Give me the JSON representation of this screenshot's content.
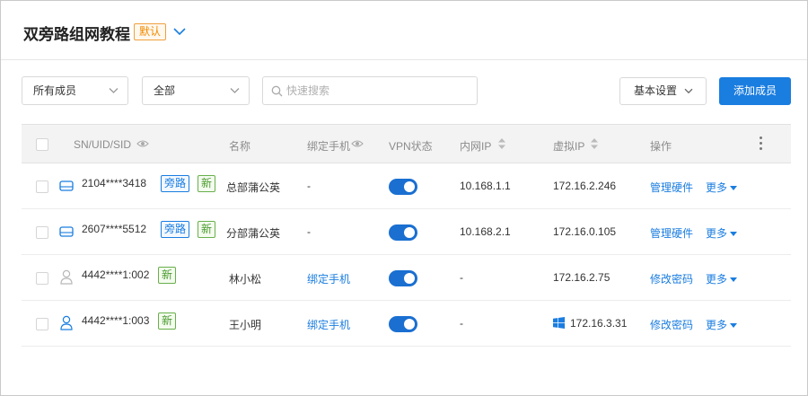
{
  "header": {
    "title": "双旁路组网教程",
    "badge": "默认"
  },
  "toolbar": {
    "member_filter": "所有成员",
    "status_filter": "全部",
    "search_placeholder": "快速搜索",
    "settings_label": "基本设置",
    "add_label": "添加成员"
  },
  "table": {
    "columns": {
      "sn": "SN/UID/SID",
      "name": "名称",
      "phone": "绑定手机",
      "vpn": "VPN状态",
      "lan_ip": "内网IP",
      "virtual_ip": "虚拟IP",
      "action": "操作"
    },
    "rows": [
      {
        "id": "2104****3418",
        "tags": [
          "旁路",
          "新"
        ],
        "name": "总部蒲公英",
        "phone": "-",
        "vpn_on": true,
        "lan_ip": "10.168.1.1",
        "virtual_ip": "172.16.2.246",
        "action": "管理硬件",
        "more": "更多",
        "icon": "router-icon"
      },
      {
        "id": "2607****5512",
        "tags": [
          "旁路",
          "新"
        ],
        "name": "分部蒲公英",
        "phone": "-",
        "vpn_on": true,
        "lan_ip": "10.168.2.1",
        "virtual_ip": "172.16.0.105",
        "action": "管理硬件",
        "more": "更多",
        "icon": "router-icon"
      },
      {
        "id": "4442****1:002",
        "tags": [
          "新"
        ],
        "name": "林小松",
        "phone": "绑定手机",
        "vpn_on": true,
        "lan_ip": "-",
        "virtual_ip": "172.16.2.75",
        "action": "修改密码",
        "more": "更多",
        "icon": "user-icon-gray"
      },
      {
        "id": "4442****1:003",
        "tags": [
          "新"
        ],
        "name": "王小明",
        "phone": "绑定手机",
        "vpn_on": true,
        "lan_ip": "-",
        "virtual_ip": "172.16.3.31",
        "action": "修改密码",
        "more": "更多",
        "icon": "user-icon-blue",
        "os_icon": "windows-icon"
      }
    ]
  },
  "colors": {
    "accent": "#1a7de0",
    "badge_orange": "#f08a00",
    "tag_green": "#4a9a2e"
  }
}
